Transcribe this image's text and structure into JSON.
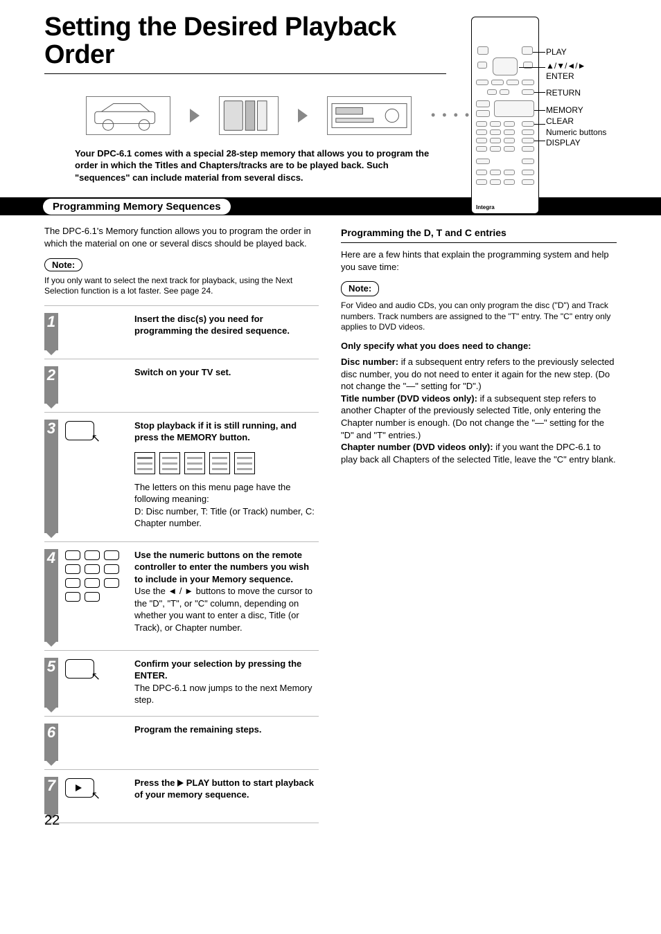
{
  "page_number": "22",
  "title": "Setting the Desired Playback Order",
  "remote_labels": {
    "play": "PLAY",
    "nav": "▲/▼/◄/►",
    "enter": "ENTER",
    "return": "RETURN",
    "memory": "MEMORY",
    "clear": "CLEAR",
    "numeric": "Numeric buttons",
    "display": "DISPLAY",
    "brand": "Integra"
  },
  "intro": "Your DPC-6.1 comes with a special 28-step memory that allows you to program the order in which the Titles and Chapters/tracks are to be played back. Such \"sequences\" can include material from several discs.",
  "section_title": "Programming Memory Sequences",
  "left": {
    "para": "The DPC-6.1's Memory function allows you to program the order in which the material on one or several discs should be played back.",
    "note_label": "Note:",
    "note_text": "If you only want to select the next track for playback, using the Next Selection function is a lot faster. See page 24."
  },
  "steps": [
    {
      "n": "1",
      "bold": "Insert the disc(s) you need for programming the desired sequence.",
      "body": ""
    },
    {
      "n": "2",
      "bold": "Switch on your TV set.",
      "body": ""
    },
    {
      "n": "3",
      "bold": "Stop playback if it is still running, and press the MEMORY button.",
      "body": "The letters on this menu page have the following meaning:\nD: Disc number, T: Title (or Track) number, C: Chapter number."
    },
    {
      "n": "4",
      "bold": "Use the numeric buttons on the remote controller to enter the numbers you wish to include in your Memory sequence.",
      "body": "Use the ◄ / ► buttons to move the cursor to the \"D\", \"T\", or \"C\" column, depending on whether you want to enter a disc, Title (or Track), or Chapter number."
    },
    {
      "n": "5",
      "bold": "Confirm your selection by pressing the ENTER.",
      "body": "The DPC-6.1 now jumps to the next Memory step."
    },
    {
      "n": "6",
      "bold": "Program the remaining steps.",
      "body": ""
    },
    {
      "n": "7",
      "bold_pre": "Press the ",
      "bold_post": " PLAY button to start playback of your memory sequence.",
      "body": ""
    }
  ],
  "right": {
    "subheading": "Programming the D, T and C entries",
    "para1": "Here are a few hints that explain the programming system and help you save time:",
    "note_label": "Note:",
    "note_text": "For Video and audio CDs, you can only program the disc (\"D\") and Track numbers. Track numbers are assigned to the \"T\" entry. The \"C\" entry only applies to DVD videos.",
    "only_heading": "Only specify what you does need to change:",
    "disc_label": "Disc number:",
    "disc_text": " if a subsequent entry refers to the previously selected disc number, you do not need to enter it again for the new step. (Do not change the \"—\" setting for \"D\".)",
    "title_label": "Title number (DVD videos only):",
    "title_text": " if a subsequent step refers to another Chapter of the previously selected Title, only entering the Chapter number is enough. (Do not change the \"—\" setting for the \"D\" and \"T\" entries.)",
    "chapter_label": "Chapter number (DVD videos only):",
    "chapter_text": " if you want the DPC-6.1 to play back all Chapters of the selected Title, leave the \"C\" entry blank."
  }
}
